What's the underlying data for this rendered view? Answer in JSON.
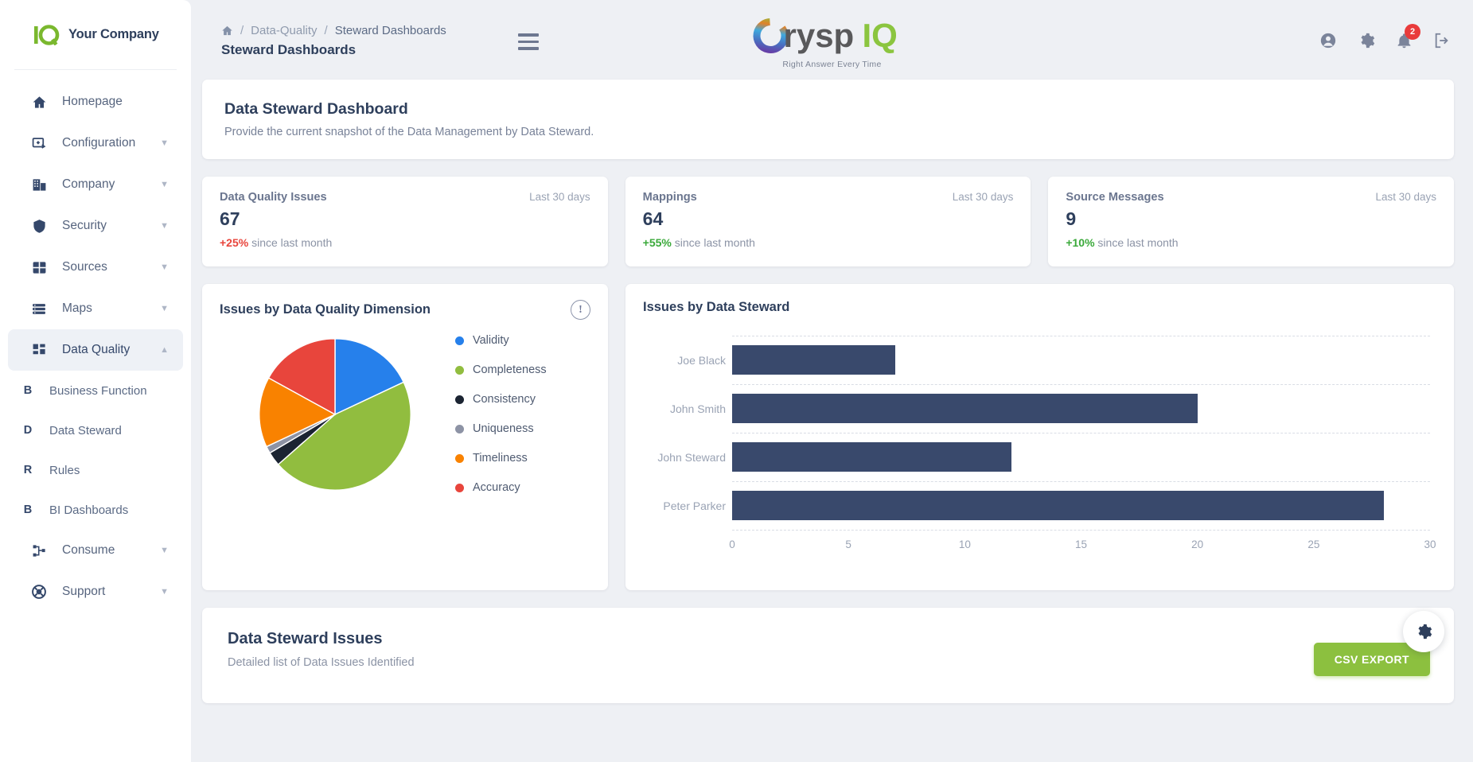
{
  "brand": {
    "name": "Your Company",
    "logo_mark": "iq-logo-icon"
  },
  "sidebar": {
    "items": [
      {
        "label": "Homepage",
        "icon": "home-icon",
        "expandable": false,
        "active": false
      },
      {
        "label": "Configuration",
        "icon": "configuration-icon",
        "expandable": true,
        "active": false
      },
      {
        "label": "Company",
        "icon": "company-icon",
        "expandable": true,
        "active": false
      },
      {
        "label": "Security",
        "icon": "shield-icon",
        "expandable": true,
        "active": false
      },
      {
        "label": "Sources",
        "icon": "grid-icon",
        "expandable": true,
        "active": false
      },
      {
        "label": "Maps",
        "icon": "maps-icon",
        "expandable": true,
        "active": false
      },
      {
        "label": "Data Quality",
        "icon": "data-quality-icon",
        "expandable": true,
        "active": true
      }
    ],
    "sub_items": [
      {
        "initial": "B",
        "label": "Business Function"
      },
      {
        "initial": "D",
        "label": "Data Steward"
      },
      {
        "initial": "R",
        "label": "Rules"
      },
      {
        "initial": "B",
        "label": "BI Dashboards"
      }
    ],
    "items_after": [
      {
        "label": "Consume",
        "icon": "consume-icon",
        "expandable": true
      },
      {
        "label": "Support",
        "icon": "support-icon",
        "expandable": true
      }
    ]
  },
  "header": {
    "breadcrumb": {
      "home_icon": "home-icon",
      "separator": "/",
      "middle": "Data-Quality",
      "last": "Steward Dashboards"
    },
    "page_title": "Steward Dashboards",
    "menu_toggle_icon": "hamburger-icon",
    "logo_text_1": "Crysp",
    "logo_text_2": "IQ",
    "logo_tagline": "Right Answer Every Time",
    "icons": [
      {
        "name": "account-icon"
      },
      {
        "name": "settings-gear-icon"
      },
      {
        "name": "notifications-bell-icon",
        "badge": "2"
      },
      {
        "name": "logout-icon"
      }
    ]
  },
  "hero": {
    "title": "Data Steward Dashboard",
    "subtitle": "Provide the current snapshot of the Data Management by Data Steward."
  },
  "kpis": [
    {
      "title": "Data Quality Issues",
      "period": "Last 30 days",
      "value": "67",
      "delta": "+25%",
      "delta_color": "#e8453c",
      "delta_suffix": " since last month"
    },
    {
      "title": "Mappings",
      "period": "Last 30 days",
      "value": "64",
      "delta": "+55%",
      "delta_color": "#3aa93a",
      "delta_suffix": " since last month"
    },
    {
      "title": "Source Messages",
      "period": "Last 30 days",
      "value": "9",
      "delta": "+10%",
      "delta_color": "#3aa93a",
      "delta_suffix": " since last month"
    }
  ],
  "pie_panel": {
    "title": "Issues by Data Quality Dimension",
    "info_icon": "info-exclamation-icon"
  },
  "bar_panel": {
    "title": "Issues by Data Steward"
  },
  "bottom": {
    "title": "Data Steward Issues",
    "subtitle": "Detailed list of Data Issues Identified",
    "export_label": "CSV EXPORT",
    "fab_icon": "settings-gear-icon"
  },
  "chart_data": [
    {
      "type": "pie",
      "title": "Issues by Data Quality Dimension",
      "legend_position": "right",
      "labels": [
        "Validity",
        "Completeness",
        "Consistency",
        "Uniqueness",
        "Timeliness",
        "Accuracy"
      ],
      "values": [
        18,
        45.5,
        3,
        1.5,
        15,
        17
      ],
      "colors": [
        "#2680eb",
        "#91bd3f",
        "#1b2432",
        "#8d93a5",
        "#f98200",
        "#e8453c"
      ]
    },
    {
      "type": "bar",
      "orientation": "horizontal",
      "title": "Issues by Data Steward",
      "categories": [
        "Joe Black",
        "John Smith",
        "John Steward",
        "Peter Parker"
      ],
      "values": [
        7,
        20,
        12,
        28
      ],
      "series": [
        {
          "name": "Issues",
          "values": [
            7,
            20,
            12,
            28
          ]
        }
      ],
      "xlabel": "",
      "ylabel": "",
      "xlim": [
        0,
        30
      ],
      "x_ticks": [
        "0",
        "5",
        "10",
        "15",
        "20",
        "25",
        "30"
      ],
      "bar_color": "#39496c",
      "grid": true
    }
  ]
}
